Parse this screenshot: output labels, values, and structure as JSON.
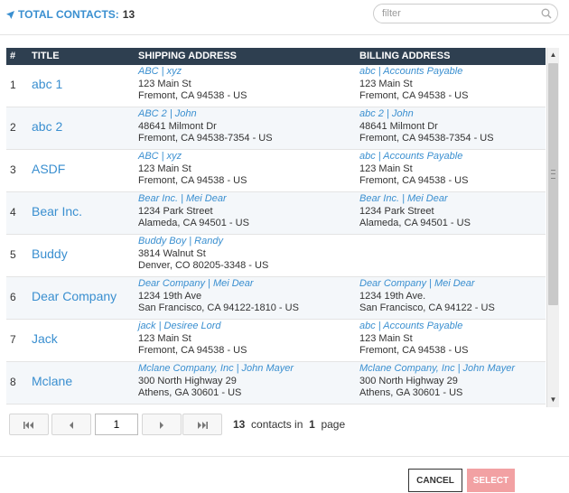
{
  "header": {
    "total_label": "TOTAL CONTACTS:",
    "total_count": "13",
    "filter_placeholder": "filter"
  },
  "table": {
    "columns": [
      "#",
      "TITLE",
      "SHIPPING ADDRESS",
      "BILLING ADDRESS"
    ],
    "rows": [
      {
        "num": "1",
        "title": "abc 1",
        "ship": {
          "name": "ABC | xyz",
          "line1": "123 Main St",
          "line2": "Fremont, CA 94538 - US"
        },
        "bill": {
          "name": "abc | Accounts Payable",
          "line1": "123 Main St",
          "line2": "Fremont, CA 94538 - US"
        }
      },
      {
        "num": "2",
        "title": "abc 2",
        "ship": {
          "name": "ABC 2 | John",
          "line1": "48641 Milmont Dr",
          "line2": "Fremont, CA 94538-7354 - US"
        },
        "bill": {
          "name": "abc 2 | John",
          "line1": "48641 Milmont Dr",
          "line2": "Fremont, CA 94538-7354 - US"
        }
      },
      {
        "num": "3",
        "title": "ASDF",
        "ship": {
          "name": "ABC | xyz",
          "line1": "123 Main St",
          "line2": "Fremont, CA 94538 - US"
        },
        "bill": {
          "name": "abc | Accounts Payable",
          "line1": "123 Main St",
          "line2": "Fremont, CA 94538 - US"
        }
      },
      {
        "num": "4",
        "title": "Bear Inc.",
        "ship": {
          "name": "Bear Inc. | Mei Dear",
          "line1": "1234 Park Street",
          "line2": "Alameda, CA 94501 - US"
        },
        "bill": {
          "name": "Bear Inc. | Mei Dear",
          "line1": "1234 Park Street",
          "line2": "Alameda, CA 94501 - US"
        }
      },
      {
        "num": "5",
        "title": "Buddy",
        "ship": {
          "name": "Buddy Boy | Randy",
          "line1": "3814 Walnut St",
          "line2": "Denver, CO 80205-3348 - US"
        },
        "bill": {
          "name": "",
          "line1": "",
          "line2": ""
        }
      },
      {
        "num": "6",
        "title": "Dear Company",
        "ship": {
          "name": "Dear Company | Mei Dear",
          "line1": "1234 19th Ave",
          "line2": "San Francisco, CA 94122-1810 - US"
        },
        "bill": {
          "name": "Dear Company | Mei Dear",
          "line1": "1234 19th Ave.",
          "line2": "San Francisco, CA 94122 - US"
        }
      },
      {
        "num": "7",
        "title": "Jack",
        "ship": {
          "name": "jack | Desiree Lord",
          "line1": "123 Main St",
          "line2": "Fremont, CA 94538 - US"
        },
        "bill": {
          "name": "abc | Accounts Payable",
          "line1": "123 Main St",
          "line2": "Fremont, CA 94538 - US"
        }
      },
      {
        "num": "8",
        "title": "Mclane",
        "ship": {
          "name": "Mclane Company, Inc | John Mayer",
          "line1": "300 North Highway 29",
          "line2": "Athens, GA 30601 - US"
        },
        "bill": {
          "name": "Mclane Company, Inc | John Mayer",
          "line1": "300 North Highway 29",
          "line2": "Athens, GA 30601 - US"
        }
      }
    ]
  },
  "pager": {
    "first_icon": "first-page-icon",
    "prev_icon": "prev-page-icon",
    "next_icon": "next-page-icon",
    "last_icon": "last-page-icon",
    "page_value": "1",
    "total": "13",
    "contacts_in": "contacts in",
    "pages": "1",
    "page_word": "page"
  },
  "footer": {
    "cancel_label": "CANCEL",
    "select_label": "SELECT"
  },
  "colors": {
    "accent": "#3a8fd0",
    "header_bg": "#2e3f50",
    "select_disabled": "#f2a1a3"
  }
}
